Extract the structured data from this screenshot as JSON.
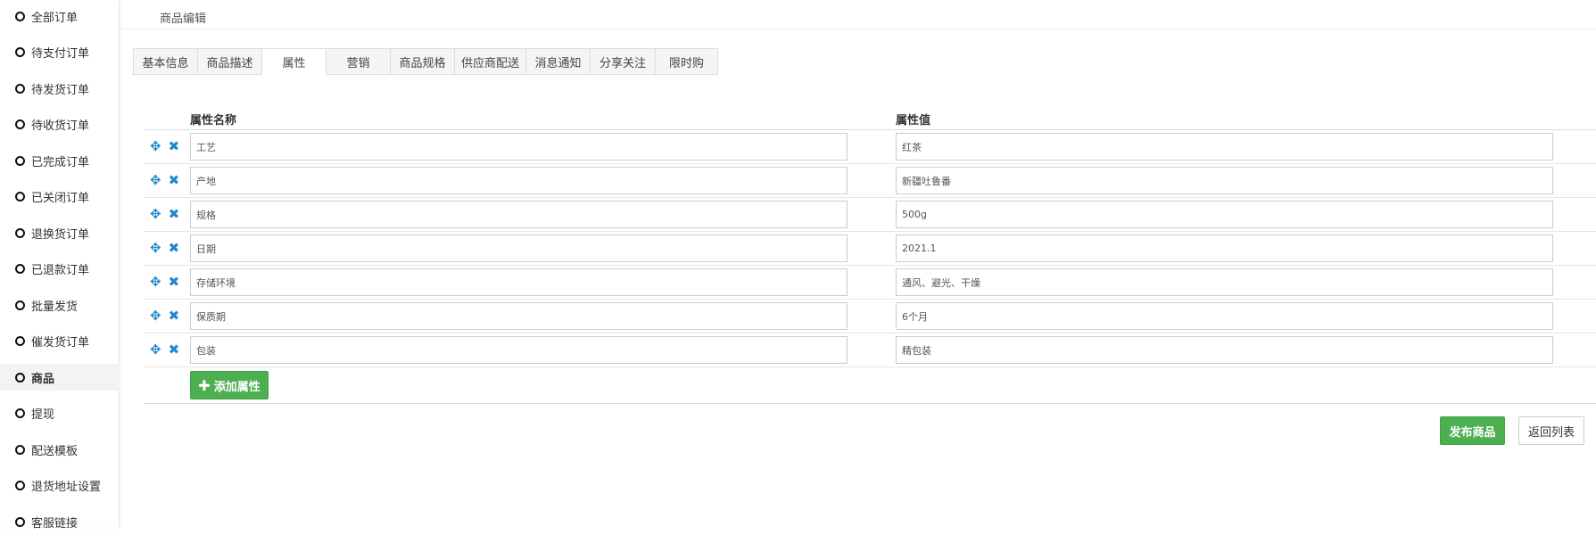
{
  "sidebar": {
    "items": [
      {
        "label": "全部订单"
      },
      {
        "label": "待支付订单"
      },
      {
        "label": "待发货订单"
      },
      {
        "label": "待收货订单"
      },
      {
        "label": "已完成订单"
      },
      {
        "label": "已关闭订单"
      },
      {
        "label": "退换货订单"
      },
      {
        "label": "已退款订单"
      },
      {
        "label": "批量发货"
      },
      {
        "label": "催发货订单"
      },
      {
        "label": "商品",
        "active": true
      },
      {
        "label": "提现"
      },
      {
        "label": "配送模板"
      },
      {
        "label": "退货地址设置"
      },
      {
        "label": "客服链接"
      }
    ]
  },
  "breadcrumb": "商品编辑",
  "tabs": [
    {
      "label": "基本信息"
    },
    {
      "label": "商品描述"
    },
    {
      "label": "属性",
      "active": true
    },
    {
      "label": "营销"
    },
    {
      "label": "商品规格"
    },
    {
      "label": "供应商配送"
    },
    {
      "label": "消息通知"
    },
    {
      "label": "分享关注"
    },
    {
      "label": "限时购"
    }
  ],
  "table": {
    "name_header": "属性名称",
    "value_header": "属性值",
    "rows": [
      {
        "name": "工艺",
        "value": "红茶"
      },
      {
        "name": "产地",
        "value": "新疆吐鲁番"
      },
      {
        "name": "规格",
        "value": "500g"
      },
      {
        "name": "日期",
        "value": "2021.1"
      },
      {
        "name": "存储环境",
        "value": "通风、避光、干燥"
      },
      {
        "name": "保质期",
        "value": "6个月"
      },
      {
        "name": "包装",
        "value": "精包装"
      }
    ]
  },
  "buttons": {
    "add_attribute": "添加属性",
    "publish": "发布商品",
    "back_to_list": "返回列表"
  },
  "icons": {
    "move": "move-icon",
    "delete": "delete-icon",
    "plus": "plus-icon"
  },
  "colors": {
    "accent_green": "#4caf50",
    "icon_blue": "#1e88c8"
  }
}
